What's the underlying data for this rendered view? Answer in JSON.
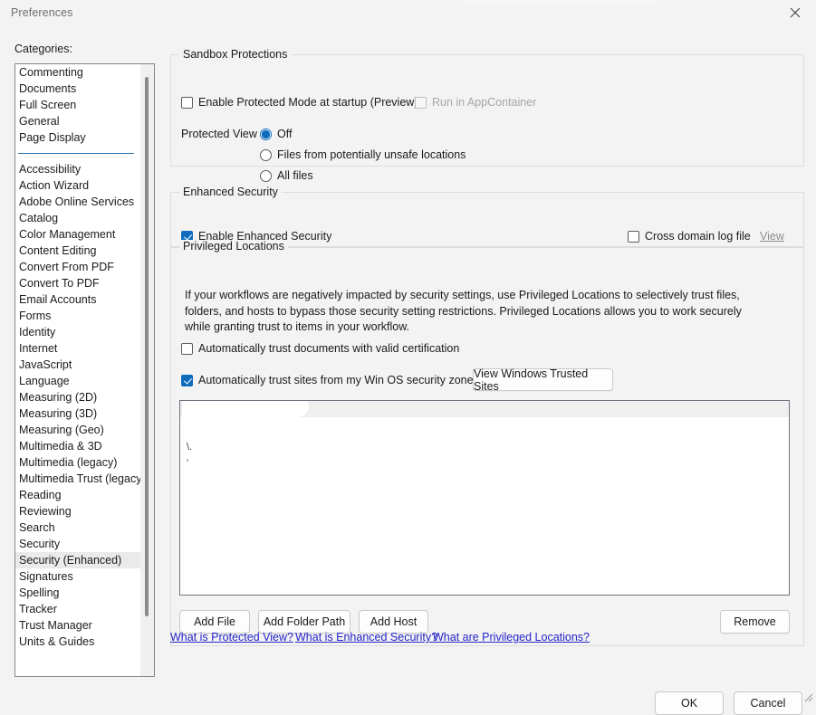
{
  "window": {
    "title": "Preferences",
    "close_icon": "close-icon"
  },
  "sidebar": {
    "label": "Categories:",
    "top_items": [
      "Commenting",
      "Documents",
      "Full Screen",
      "General",
      "Page Display"
    ],
    "items": [
      "Accessibility",
      "Action Wizard",
      "Adobe Online Services",
      "Catalog",
      "Color Management",
      "Content Editing",
      "Convert From PDF",
      "Convert To PDF",
      "Email Accounts",
      "Forms",
      "Identity",
      "Internet",
      "JavaScript",
      "Language",
      "Measuring (2D)",
      "Measuring (3D)",
      "Measuring (Geo)",
      "Multimedia & 3D",
      "Multimedia (legacy)",
      "Multimedia Trust (legacy)",
      "Reading",
      "Reviewing",
      "Search",
      "Security",
      "Security (Enhanced)",
      "Signatures",
      "Spelling",
      "Tracker",
      "Trust Manager",
      "Units & Guides"
    ],
    "selected": "Security (Enhanced)"
  },
  "sandbox": {
    "title": "Sandbox Protections",
    "enable_protected_mode": {
      "label": "Enable Protected Mode at startup (Preview)",
      "checked": false
    },
    "run_in_appcontainer": {
      "label": "Run in AppContainer",
      "checked": false,
      "disabled": true
    },
    "protected_view_label": "Protected View",
    "protected_view_options": [
      {
        "label": "Off",
        "selected": true
      },
      {
        "label": "Files from potentially unsafe locations",
        "selected": false
      },
      {
        "label": "All files",
        "selected": false
      }
    ]
  },
  "enhanced_security": {
    "title": "Enhanced Security",
    "enable": {
      "label": "Enable Enhanced Security",
      "checked": true
    },
    "cross_domain_log": {
      "label": "Cross domain log file",
      "checked": false
    },
    "view_link": "View"
  },
  "privileged_locations": {
    "title": "Privileged Locations",
    "description": "If your workflows are negatively impacted by security settings, use Privileged Locations to selectively trust files, folders, and hosts to bypass those security setting restrictions. Privileged Locations allows you to work securely while granting trust to items in your workflow.",
    "auto_trust_documents": {
      "label": "Automatically trust documents with valid certification",
      "checked": false
    },
    "auto_trust_sites": {
      "label": "Automatically trust sites from my Win OS security zones",
      "checked": true
    },
    "view_windows_trusted_sites": "View Windows Trusted Sites",
    "list_entries": [
      "\\.",
      "'"
    ],
    "buttons": {
      "add_file": "Add File",
      "add_folder_path": "Add Folder Path",
      "add_host": "Add Host",
      "remove": "Remove"
    }
  },
  "help_links": [
    "What is Protected View?",
    "What is Enhanced Security?",
    "What are Privileged Locations?"
  ],
  "footer": {
    "ok": "OK",
    "cancel": "Cancel"
  },
  "colors": {
    "accent": "#0f6cbd",
    "link": "#2424c8",
    "divider": "#2b6cb0",
    "window_bg": "#f3f3f3"
  }
}
